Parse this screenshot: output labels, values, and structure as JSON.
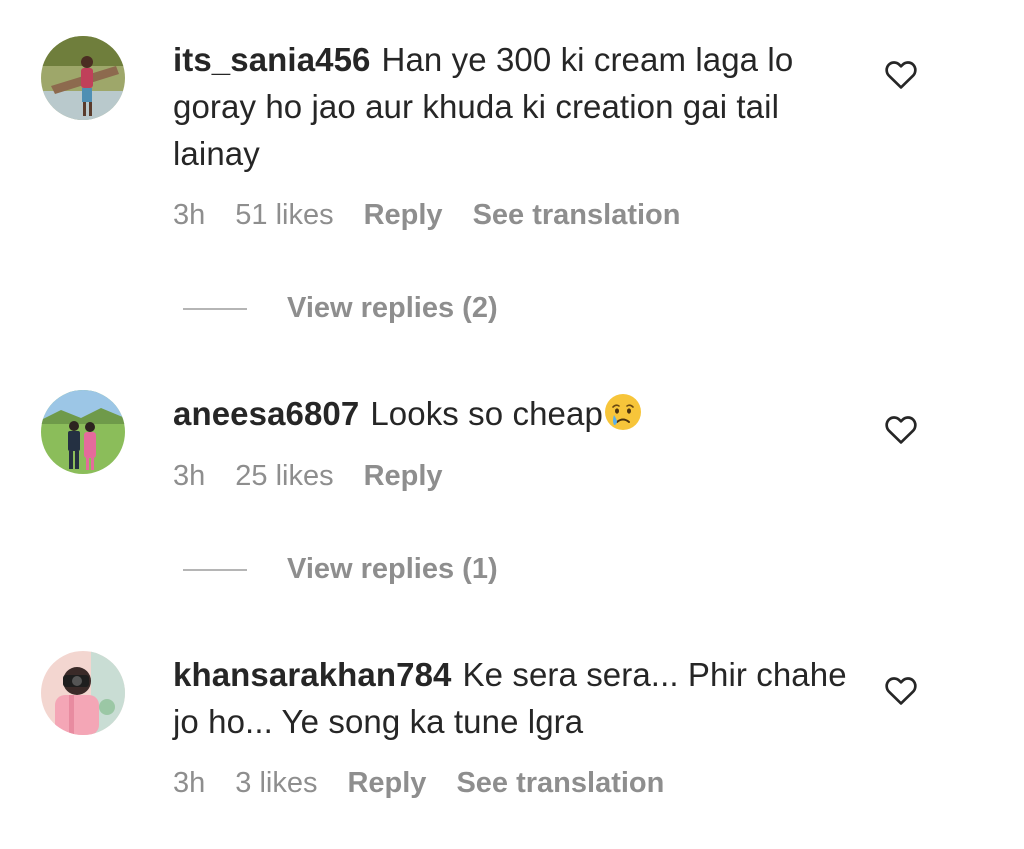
{
  "comments": [
    {
      "username": "its_sania456",
      "text": "Han ye 300 ki cream laga lo goray ho jao aur khuda ki creation gai tail lainay",
      "time": "3h",
      "likes": "51 likes",
      "reply": "Reply",
      "translate": "See translation",
      "view_replies": "View replies (2)"
    },
    {
      "username": "aneesa6807",
      "text": "Looks so cheap",
      "emoji": "crying-face",
      "time": "3h",
      "likes": "25 likes",
      "reply": "Reply",
      "view_replies": "View replies (1)"
    },
    {
      "username": "khansarakhan784",
      "text": "Ke sera sera... Phir chahe jo ho... Ye song ka tune lgra",
      "time": "3h",
      "likes": "3 likes",
      "reply": "Reply",
      "translate": "See translation"
    }
  ],
  "icons": {
    "like": "heart-icon"
  },
  "colors": {
    "text": "#262626",
    "muted": "#8e8e8e",
    "divider": "#b5b5b5"
  }
}
